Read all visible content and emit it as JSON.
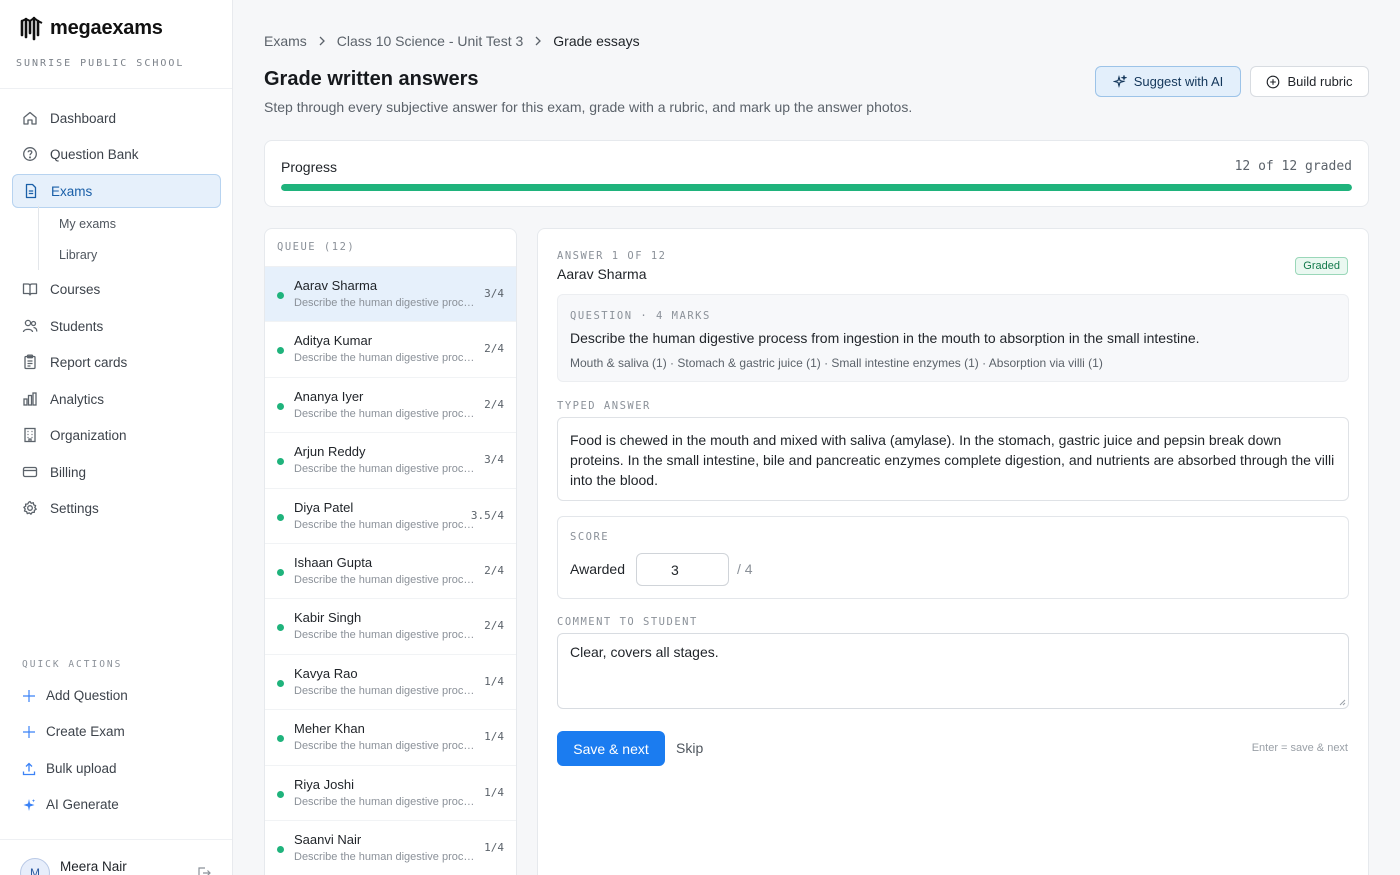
{
  "brand": {
    "name": "megaexams",
    "school": "SUNRISE PUBLIC SCHOOL"
  },
  "sidebar": {
    "items": [
      {
        "label": "Dashboard",
        "icon": "home-icon"
      },
      {
        "label": "Question Bank",
        "icon": "question-circle-icon"
      },
      {
        "label": "Exams",
        "icon": "document-icon",
        "active": true
      },
      {
        "label": "Courses",
        "icon": "book-open-icon"
      },
      {
        "label": "Students",
        "icon": "users-icon"
      },
      {
        "label": "Report cards",
        "icon": "clipboard-icon"
      },
      {
        "label": "Analytics",
        "icon": "bar-chart-icon"
      },
      {
        "label": "Organization",
        "icon": "building-icon"
      },
      {
        "label": "Billing",
        "icon": "credit-card-icon"
      },
      {
        "label": "Settings",
        "icon": "gear-icon"
      }
    ],
    "exam_sub": [
      "My exams",
      "Library"
    ],
    "quick_actions_title": "QUICK ACTIONS",
    "quick_actions": [
      {
        "label": "Add Question",
        "icon": "plus-icon"
      },
      {
        "label": "Create Exam",
        "icon": "plus-icon"
      },
      {
        "label": "Bulk upload",
        "icon": "upload-icon"
      },
      {
        "label": "AI Generate",
        "icon": "sparkle-icon"
      }
    ],
    "user": {
      "initial": "M",
      "name": "Meera Nair"
    }
  },
  "breadcrumb": [
    "Exams",
    "Class 10 Science - Unit Test 3",
    "Grade essays"
  ],
  "page": {
    "title": "Grade written answers",
    "subtitle": "Step through every subjective answer for this exam, grade with a rubric, and mark up the answer photos.",
    "suggest_ai": "Suggest with AI",
    "build_rubric": "Build rubric"
  },
  "progress": {
    "label": "Progress",
    "count_text": "12 of 12 graded",
    "fraction": 1.0
  },
  "queue": {
    "title": "QUEUE (12)",
    "items": [
      {
        "name": "Aarav Sharma",
        "excerpt": "Describe the human digestive process from ingestion in the mouth",
        "score": "3/4",
        "active": true
      },
      {
        "name": "Aditya Kumar",
        "excerpt": "Describe the human digestive process from ingestion in the mouth",
        "score": "2/4"
      },
      {
        "name": "Ananya Iyer",
        "excerpt": "Describe the human digestive process from ingestion in the mouth",
        "score": "2/4"
      },
      {
        "name": "Arjun Reddy",
        "excerpt": "Describe the human digestive process from ingestion in the mouth",
        "score": "3/4"
      },
      {
        "name": "Diya Patel",
        "excerpt": "Describe the human digestive process from ingestion in the mouth",
        "score": "3.5/4"
      },
      {
        "name": "Ishaan Gupta",
        "excerpt": "Describe the human digestive process from ingestion in the mouth",
        "score": "2/4"
      },
      {
        "name": "Kabir Singh",
        "excerpt": "Describe the human digestive process from ingestion in the mouth",
        "score": "2/4"
      },
      {
        "name": "Kavya Rao",
        "excerpt": "Describe the human digestive process from ingestion in the mouth",
        "score": "1/4"
      },
      {
        "name": "Meher Khan",
        "excerpt": "Describe the human digestive process from ingestion in the mouth",
        "score": "1/4"
      },
      {
        "name": "Riya Joshi",
        "excerpt": "Describe the human digestive process from ingestion in the mouth",
        "score": "1/4"
      },
      {
        "name": "Saanvi Nair",
        "excerpt": "Describe the human digestive process from ingestion in the mouth",
        "score": "1/4"
      }
    ]
  },
  "answer": {
    "count": "ANSWER 1 OF 12",
    "student": "Aarav Sharma",
    "status": "Graded",
    "question_head": "QUESTION · 4 MARKS",
    "question": "Describe the human digestive process from ingestion in the mouth to absorption in the small intestine.",
    "rubric": "Mouth & saliva (1) · Stomach & gastric juice (1) · Small intestine enzymes (1) · Absorption via villi (1)",
    "typed_label": "TYPED ANSWER",
    "typed": "Food is chewed in the mouth and mixed with saliva (amylase). In the stomach, gastric juice and pepsin break down proteins. In the small intestine, bile and pancreatic enzymes complete digestion, and nutrients are absorbed through the villi into the blood.",
    "score_label": "SCORE",
    "awarded_label": "Awarded",
    "awarded_value": "3",
    "out_of": "/ 4",
    "comment_label": "COMMENT TO STUDENT",
    "comment": "Clear, covers all stages.",
    "save_next": "Save & next",
    "skip": "Skip",
    "hint": "Enter = save & next"
  },
  "colors": {
    "accent": "#1b7cf0",
    "success": "#1fb37c",
    "active_bg": "#e6f0fb"
  }
}
